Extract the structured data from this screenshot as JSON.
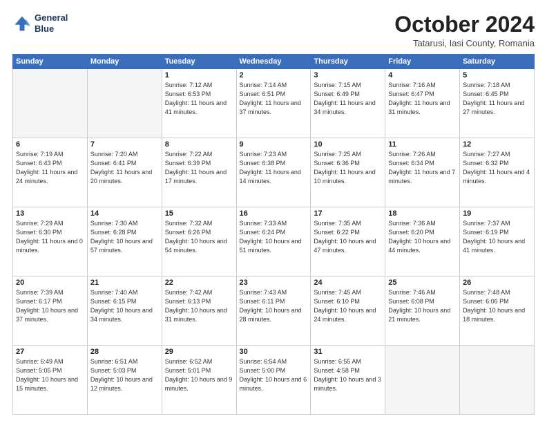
{
  "header": {
    "logo_line1": "General",
    "logo_line2": "Blue",
    "month_title": "October 2024",
    "subtitle": "Tatarusi, Iasi County, Romania"
  },
  "weekdays": [
    "Sunday",
    "Monday",
    "Tuesday",
    "Wednesday",
    "Thursday",
    "Friday",
    "Saturday"
  ],
  "weeks": [
    [
      {
        "day": null
      },
      {
        "day": null
      },
      {
        "day": "1",
        "sunrise": "Sunrise: 7:12 AM",
        "sunset": "Sunset: 6:53 PM",
        "daylight": "Daylight: 11 hours and 41 minutes."
      },
      {
        "day": "2",
        "sunrise": "Sunrise: 7:14 AM",
        "sunset": "Sunset: 6:51 PM",
        "daylight": "Daylight: 11 hours and 37 minutes."
      },
      {
        "day": "3",
        "sunrise": "Sunrise: 7:15 AM",
        "sunset": "Sunset: 6:49 PM",
        "daylight": "Daylight: 11 hours and 34 minutes."
      },
      {
        "day": "4",
        "sunrise": "Sunrise: 7:16 AM",
        "sunset": "Sunset: 6:47 PM",
        "daylight": "Daylight: 11 hours and 31 minutes."
      },
      {
        "day": "5",
        "sunrise": "Sunrise: 7:18 AM",
        "sunset": "Sunset: 6:45 PM",
        "daylight": "Daylight: 11 hours and 27 minutes."
      }
    ],
    [
      {
        "day": "6",
        "sunrise": "Sunrise: 7:19 AM",
        "sunset": "Sunset: 6:43 PM",
        "daylight": "Daylight: 11 hours and 24 minutes."
      },
      {
        "day": "7",
        "sunrise": "Sunrise: 7:20 AM",
        "sunset": "Sunset: 6:41 PM",
        "daylight": "Daylight: 11 hours and 20 minutes."
      },
      {
        "day": "8",
        "sunrise": "Sunrise: 7:22 AM",
        "sunset": "Sunset: 6:39 PM",
        "daylight": "Daylight: 11 hours and 17 minutes."
      },
      {
        "day": "9",
        "sunrise": "Sunrise: 7:23 AM",
        "sunset": "Sunset: 6:38 PM",
        "daylight": "Daylight: 11 hours and 14 minutes."
      },
      {
        "day": "10",
        "sunrise": "Sunrise: 7:25 AM",
        "sunset": "Sunset: 6:36 PM",
        "daylight": "Daylight: 11 hours and 10 minutes."
      },
      {
        "day": "11",
        "sunrise": "Sunrise: 7:26 AM",
        "sunset": "Sunset: 6:34 PM",
        "daylight": "Daylight: 11 hours and 7 minutes."
      },
      {
        "day": "12",
        "sunrise": "Sunrise: 7:27 AM",
        "sunset": "Sunset: 6:32 PM",
        "daylight": "Daylight: 11 hours and 4 minutes."
      }
    ],
    [
      {
        "day": "13",
        "sunrise": "Sunrise: 7:29 AM",
        "sunset": "Sunset: 6:30 PM",
        "daylight": "Daylight: 11 hours and 0 minutes."
      },
      {
        "day": "14",
        "sunrise": "Sunrise: 7:30 AM",
        "sunset": "Sunset: 6:28 PM",
        "daylight": "Daylight: 10 hours and 57 minutes."
      },
      {
        "day": "15",
        "sunrise": "Sunrise: 7:32 AM",
        "sunset": "Sunset: 6:26 PM",
        "daylight": "Daylight: 10 hours and 54 minutes."
      },
      {
        "day": "16",
        "sunrise": "Sunrise: 7:33 AM",
        "sunset": "Sunset: 6:24 PM",
        "daylight": "Daylight: 10 hours and 51 minutes."
      },
      {
        "day": "17",
        "sunrise": "Sunrise: 7:35 AM",
        "sunset": "Sunset: 6:22 PM",
        "daylight": "Daylight: 10 hours and 47 minutes."
      },
      {
        "day": "18",
        "sunrise": "Sunrise: 7:36 AM",
        "sunset": "Sunset: 6:20 PM",
        "daylight": "Daylight: 10 hours and 44 minutes."
      },
      {
        "day": "19",
        "sunrise": "Sunrise: 7:37 AM",
        "sunset": "Sunset: 6:19 PM",
        "daylight": "Daylight: 10 hours and 41 minutes."
      }
    ],
    [
      {
        "day": "20",
        "sunrise": "Sunrise: 7:39 AM",
        "sunset": "Sunset: 6:17 PM",
        "daylight": "Daylight: 10 hours and 37 minutes."
      },
      {
        "day": "21",
        "sunrise": "Sunrise: 7:40 AM",
        "sunset": "Sunset: 6:15 PM",
        "daylight": "Daylight: 10 hours and 34 minutes."
      },
      {
        "day": "22",
        "sunrise": "Sunrise: 7:42 AM",
        "sunset": "Sunset: 6:13 PM",
        "daylight": "Daylight: 10 hours and 31 minutes."
      },
      {
        "day": "23",
        "sunrise": "Sunrise: 7:43 AM",
        "sunset": "Sunset: 6:11 PM",
        "daylight": "Daylight: 10 hours and 28 minutes."
      },
      {
        "day": "24",
        "sunrise": "Sunrise: 7:45 AM",
        "sunset": "Sunset: 6:10 PM",
        "daylight": "Daylight: 10 hours and 24 minutes."
      },
      {
        "day": "25",
        "sunrise": "Sunrise: 7:46 AM",
        "sunset": "Sunset: 6:08 PM",
        "daylight": "Daylight: 10 hours and 21 minutes."
      },
      {
        "day": "26",
        "sunrise": "Sunrise: 7:48 AM",
        "sunset": "Sunset: 6:06 PM",
        "daylight": "Daylight: 10 hours and 18 minutes."
      }
    ],
    [
      {
        "day": "27",
        "sunrise": "Sunrise: 6:49 AM",
        "sunset": "Sunset: 5:05 PM",
        "daylight": "Daylight: 10 hours and 15 minutes."
      },
      {
        "day": "28",
        "sunrise": "Sunrise: 6:51 AM",
        "sunset": "Sunset: 5:03 PM",
        "daylight": "Daylight: 10 hours and 12 minutes."
      },
      {
        "day": "29",
        "sunrise": "Sunrise: 6:52 AM",
        "sunset": "Sunset: 5:01 PM",
        "daylight": "Daylight: 10 hours and 9 minutes."
      },
      {
        "day": "30",
        "sunrise": "Sunrise: 6:54 AM",
        "sunset": "Sunset: 5:00 PM",
        "daylight": "Daylight: 10 hours and 6 minutes."
      },
      {
        "day": "31",
        "sunrise": "Sunrise: 6:55 AM",
        "sunset": "Sunset: 4:58 PM",
        "daylight": "Daylight: 10 hours and 3 minutes."
      },
      {
        "day": null
      },
      {
        "day": null
      }
    ]
  ]
}
